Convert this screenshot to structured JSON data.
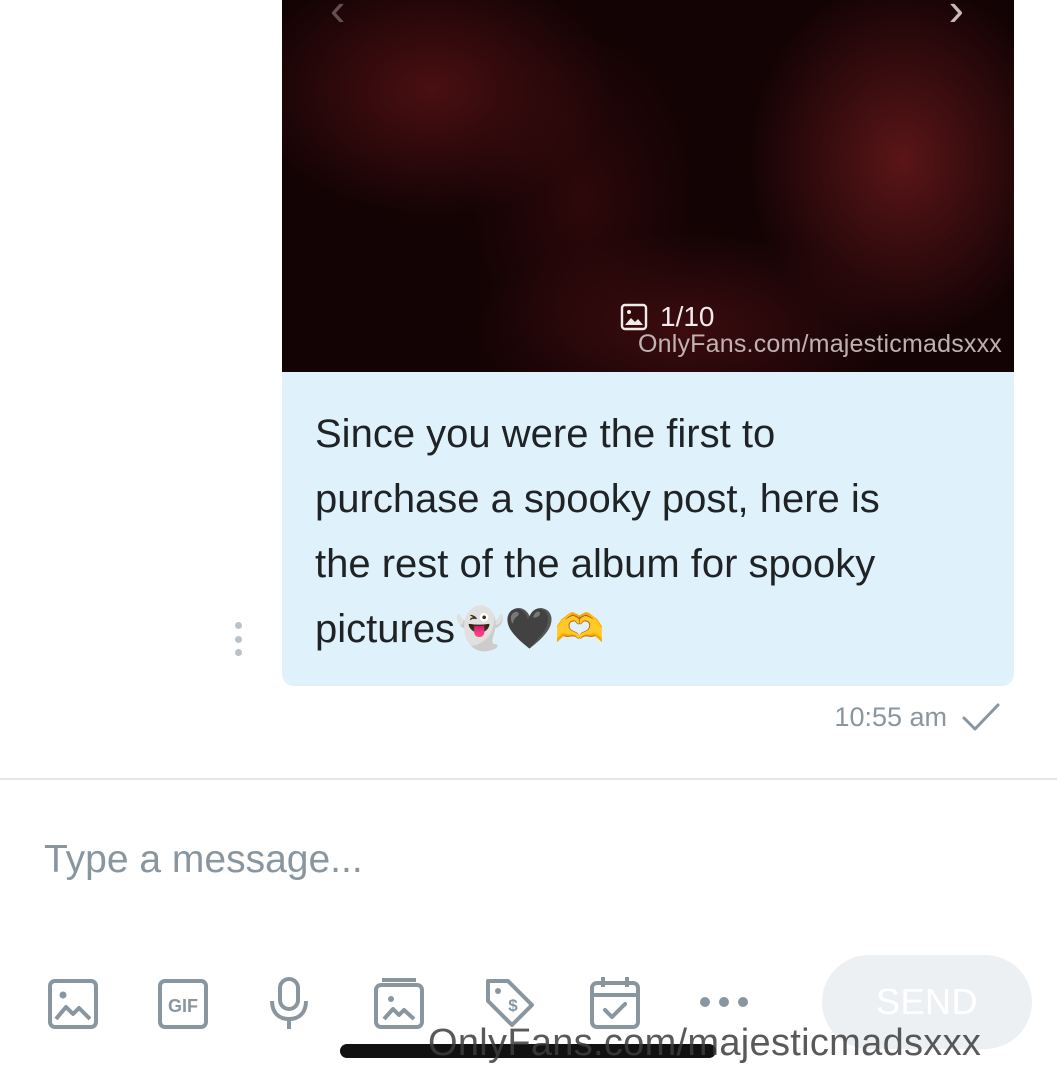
{
  "media": {
    "counter": "1/10",
    "watermark": "OnlyFans.com/majesticmadsxxx",
    "prev_arrow": "‹",
    "next_arrow": "›"
  },
  "message": {
    "text": "Since you were the first to purchase a spooky post, here is the rest of the album for spooky pictures👻🖤🫶",
    "timestamp": "10:55 am",
    "status_icon": "checkmark-icon",
    "background": "#dff1fa"
  },
  "composer": {
    "placeholder": "Type a message..."
  },
  "toolbar": {
    "icons": [
      "image-icon",
      "gif-icon",
      "microphone-icon",
      "media-vault-icon",
      "price-tag-icon",
      "schedule-icon",
      "more-icon"
    ],
    "send_label": "SEND"
  },
  "footer_watermark": "OnlyFans.com/majesticmadsxxx"
}
